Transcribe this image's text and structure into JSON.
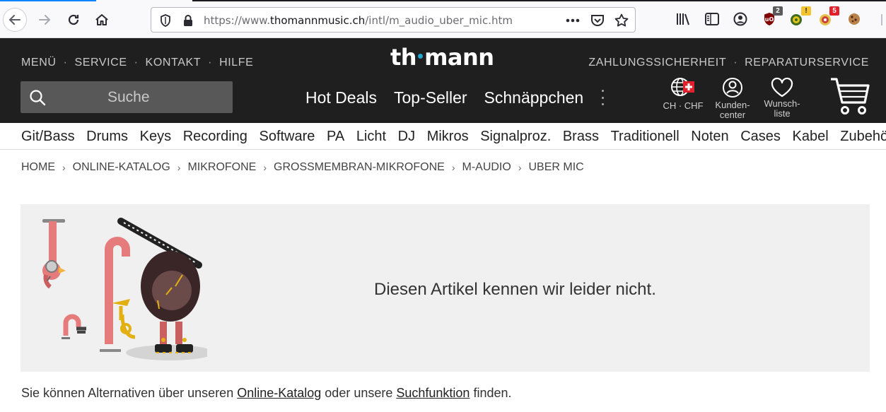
{
  "browser": {
    "url_scheme": "https://www.",
    "url_host": "thomannmusic.ch",
    "url_path": "/intl/m_audio_uber_mic.htm",
    "extensions": [
      {
        "name": "ublock-icon",
        "badge": "2",
        "badge_color": "#5a5a5a"
      },
      {
        "name": "privacy-extension-icon",
        "badge": "!",
        "badge_color": "#f4c430"
      },
      {
        "name": "bug-extension-icon",
        "badge": "5",
        "badge_color": "#e0202b"
      }
    ]
  },
  "header": {
    "left_links": [
      "MENÜ",
      "SERVICE",
      "KONTAKT",
      "HILFE"
    ],
    "right_links": [
      "ZAHLUNGSSICHERHEIT",
      "REPARATURSERVICE"
    ],
    "logo_part1": "th",
    "logo_part2": "mann",
    "search_placeholder": "Suche",
    "main_nav": [
      "Hot Deals",
      "Top-Seller",
      "Schnäppchen"
    ],
    "currency_label": "CH · CHF",
    "account_label_1": "Kunden-",
    "account_label_2": "center",
    "wishlist_label_1": "Wunsch-",
    "wishlist_label_2": "liste"
  },
  "categories": [
    "Git/Bass",
    "Drums",
    "Keys",
    "Recording",
    "Software",
    "PA",
    "Licht",
    "DJ",
    "Mikros",
    "Signalproz.",
    "Brass",
    "Traditionell",
    "Noten",
    "Cases",
    "Kabel",
    "Zubehör"
  ],
  "breadcrumb": [
    "HOME",
    "ONLINE-KATALOG",
    "MIKROFONE",
    "GROSSMEMBRAN-MIKROFONE",
    "M-AUDIO",
    "UBER MIC"
  ],
  "error": {
    "message": "Diesen Artikel kennen wir leider nicht."
  },
  "info": {
    "prefix": "Sie können Alternativen über unseren ",
    "link1": "Online-Katalog",
    "middle": " oder unsere ",
    "link2": "Suchfunktion",
    "suffix": " finden."
  },
  "colors": {
    "header_bg": "#1f1f1f",
    "logo_accent": "#1ea7d0",
    "panel_bg": "#f0f0f0"
  }
}
